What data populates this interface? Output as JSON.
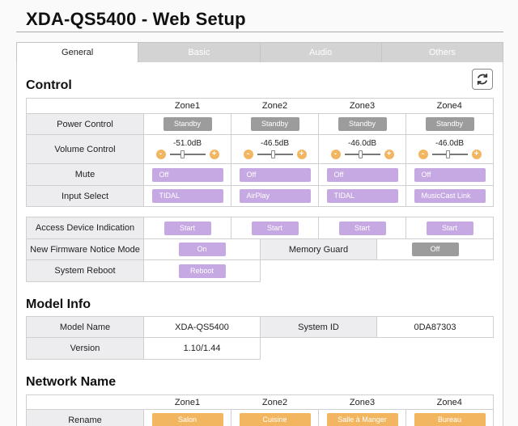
{
  "page": {
    "title": "XDA-QS5400 - Web Setup"
  },
  "tabs": [
    {
      "label": "General",
      "active": true
    },
    {
      "label": "Basic",
      "active": false
    },
    {
      "label": "Audio",
      "active": false
    },
    {
      "label": "Others",
      "active": false
    }
  ],
  "control": {
    "title": "Control",
    "zones": [
      "Zone1",
      "Zone2",
      "Zone3",
      "Zone4"
    ],
    "power": {
      "label": "Power Control",
      "values": [
        "Standby",
        "Standby",
        "Standby",
        "Standby"
      ]
    },
    "volume": {
      "label": "Volume Control",
      "values": [
        "-51.0dB",
        "-46.5dB",
        "-46.0dB",
        "-46.0dB"
      ],
      "levels": [
        0.35,
        0.45,
        0.46,
        0.46
      ],
      "minus": "-",
      "plus": "+"
    },
    "mute": {
      "label": "Mute",
      "values": [
        "Off",
        "Off",
        "Off",
        "Off"
      ]
    },
    "input": {
      "label": "Input Select",
      "values": [
        "TIDAL",
        "AirPlay",
        "TIDAL",
        "MusicCast Link"
      ]
    },
    "access": {
      "label": "Access Device Indication",
      "values": [
        "Start",
        "Start",
        "Start",
        "Start"
      ]
    },
    "firmware": {
      "label": "New Firmware Notice Mode",
      "value": "On"
    },
    "memory_guard": {
      "label": "Memory Guard",
      "value": "Off"
    },
    "reboot": {
      "label": "System Reboot",
      "value": "Reboot"
    }
  },
  "model_info": {
    "title": "Model Info",
    "model_name": {
      "label": "Model Name",
      "value": "XDA-QS5400"
    },
    "system_id": {
      "label": "System ID",
      "value": "0DA87303"
    },
    "version": {
      "label": "Version",
      "value": "1.10/1.44"
    }
  },
  "network_name": {
    "title": "Network Name",
    "zones": [
      "Zone1",
      "Zone2",
      "Zone3",
      "Zone4"
    ],
    "rename": {
      "label": "Rename",
      "values": [
        "Salon",
        "Cuisine",
        "Salle à Manger",
        "Bureau"
      ]
    }
  },
  "colors": {
    "accent_orange": "#f3b660",
    "button_purple": "#c6a8e3",
    "button_gray": "#9c9c9c",
    "label_bg": "#ededf0"
  },
  "icons": {
    "refresh": "refresh-icon"
  }
}
